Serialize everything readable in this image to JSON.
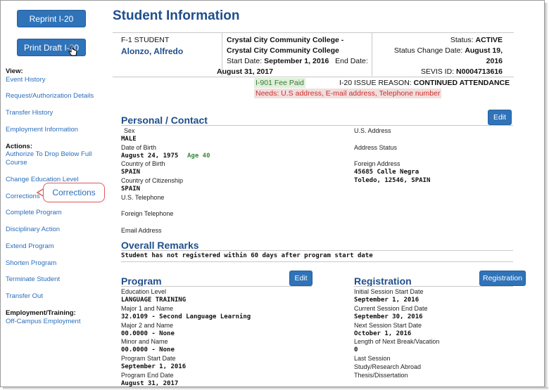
{
  "buttons": {
    "reprint": "Reprint I-20",
    "print_draft": "Print Draft I-20",
    "edit_personal": "Edit",
    "edit_program": "Edit",
    "registration": "Registration"
  },
  "sidebar": {
    "view_heading": "View:",
    "view_links": [
      "Event History",
      "Request/Authorization Details",
      "Transfer History",
      "Employment Information"
    ],
    "actions_heading": "Actions:",
    "action_links": [
      "Authorize To Drop Below Full",
      "Course",
      "Change Education Level",
      "Corrections",
      "Complete Program",
      "Disciplinary Action",
      "Extend Program",
      "Shorten Program",
      "Terminate Student",
      "Transfer Out"
    ],
    "employment_heading": "Employment/Training:",
    "employment_links": [
      "Off-Campus Employment"
    ]
  },
  "callout": {
    "label": "Corrections"
  },
  "page": {
    "title": "Student Information"
  },
  "student": {
    "type": "F-1 STUDENT",
    "name": "Alonzo, Alfredo",
    "school_line1": "Crystal City Community College -",
    "school_line2": "Crystal City Community College",
    "start_label": "Start Date:",
    "start_value": "September 1, 2016",
    "end_label": "End Date:",
    "end_value": "August 31, 2017",
    "status_label": "Status:",
    "status_value": "ACTIVE",
    "status_change_label": "Status Change Date:",
    "status_change_value": "August 19,",
    "status_change_year": "2016",
    "sevis_label": "SEVIS ID:",
    "sevis_value": "N0004713616",
    "fee_paid": "I-901 Fee Paid",
    "issue_reason_label": "I-20 ISSUE REASON:",
    "issue_reason_value": "CONTINUED ATTENDANCE",
    "needs": "Needs: U.S address, E-mail address, Telephone number"
  },
  "personal": {
    "heading": "Personal / Contact",
    "sex_label": "Sex",
    "sex_value": "MALE",
    "dob_label": "Date of Birth",
    "dob_value": "August 24, 1975",
    "age": "Age 40",
    "cob_label": "Country of Birth",
    "cob_value": "SPAIN",
    "coc_label": "Country of Citizenship",
    "coc_value": "SPAIN",
    "us_phone_label": "U.S. Telephone",
    "foreign_phone_label": "Foreign Telephone",
    "email_label": "Email Address",
    "us_address_label": "U.S. Address",
    "address_status_label": "Address Status",
    "foreign_address_label": "Foreign Address",
    "foreign_address_line1": "45685 Calle Negra",
    "foreign_address_line2": "Toledo,  12546,  SPAIN"
  },
  "remarks": {
    "heading": "Overall Remarks",
    "text": "Student has not registered within 60 days after program start date"
  },
  "program": {
    "heading": "Program",
    "edu_level_label": "Education Level",
    "edu_level_value": "LANGUAGE TRAINING",
    "major1_label": "Major 1 and Name",
    "major1_value": "32.0109 - Second Language Learning",
    "major2_label": "Major 2 and Name",
    "major2_value": "00.0000 - None",
    "minor_label": "Minor and Name",
    "minor_value": "00.0000 - None",
    "start_label": "Program Start Date",
    "start_value": "September 1, 2016",
    "end_label": "Program End Date",
    "end_value": "August 31, 2017"
  },
  "registration": {
    "heading": "Registration",
    "init_label": "Initial Session Start Date",
    "init_value": "September 1, 2016",
    "cur_end_label": "Current Session End Date",
    "cur_end_value": "September 30, 2016",
    "next_label": "Next Session Start Date",
    "next_value": "October 1, 2016",
    "break_label": "Length of Next Break/Vacation",
    "break_value": "0",
    "last_label": "Last Session",
    "study_label": "Study/Research Abroad",
    "dissertation_label": "Thesis/Dissertation"
  },
  "colors": {
    "accent": "#2f73b9",
    "heading": "#1f4e8c",
    "link": "#2a6ebb",
    "fee_bg": "#dff0d8",
    "needs_bg": "#f2dede",
    "callout_border": "#e05a5a"
  },
  "icons": {
    "cursor": "hand-pointer-icon"
  }
}
